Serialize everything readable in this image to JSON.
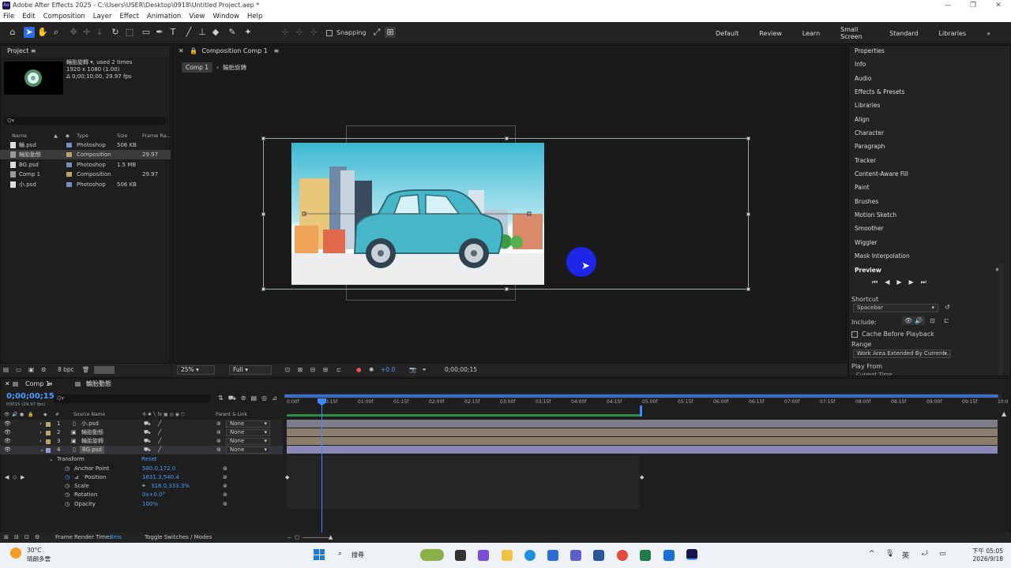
{
  "window": {
    "title": "Adobe After Effects 2025 - C:\\Users\\USER\\Desktop\\0918\\Untitled Project.aep *"
  },
  "menu": [
    "File",
    "Edit",
    "Composition",
    "Layer",
    "Effect",
    "Animation",
    "View",
    "Window",
    "Help"
  ],
  "toolbar": {
    "snapping_label": "Snapping"
  },
  "workspaces": [
    "Default",
    "Review",
    "Learn",
    "Small Screen",
    "Standard",
    "Libraries"
  ],
  "project": {
    "title": "Project",
    "selected_name": "輪胎旋轉",
    "used": ", used 2 times",
    "dims": "1920 x 1080 (1.00)",
    "duration": "Δ 0;00;10;00, 29.97 fps",
    "search_placeholder": "Q▾",
    "columns": [
      "Name",
      "Type",
      "Size",
      "Frame Ra..."
    ],
    "rows": [
      {
        "name": "輪.psd",
        "type": "Photoshop",
        "size": "506 KB",
        "rate": ""
      },
      {
        "name": "輪胎動態",
        "type": "Composition",
        "size": "",
        "rate": "29.97"
      },
      {
        "name": "BG.psd",
        "type": "Photoshop",
        "size": "1.5 MB",
        "rate": ""
      },
      {
        "name": "Comp 1",
        "type": "Composition",
        "size": "",
        "rate": "29.97"
      },
      {
        "name": "小.psd",
        "type": "Photoshop",
        "size": "506 KB",
        "rate": ""
      }
    ],
    "bpc": "8 bpc"
  },
  "comp": {
    "tab": "Composition Comp 1",
    "crumb_active": "Comp 1",
    "crumb_next": "輪胎旋轉",
    "zoom": "25%",
    "resolution": "Full",
    "exposure": "+0.0",
    "timecode": "0;00;00;15"
  },
  "right_panel": [
    "Properties",
    "Info",
    "Audio",
    "Effects & Presets",
    "Libraries",
    "Align",
    "Character",
    "Paragraph",
    "Tracker",
    "Content-Aware Fill",
    "Paint",
    "Brushes",
    "Motion Sketch",
    "Smoother",
    "Wiggler",
    "Mask Interpolation"
  ],
  "preview": {
    "title": "Preview",
    "shortcut_label": "Shortcut",
    "shortcut_value": "Spacebar",
    "include_label": "Include:",
    "cache_label": "Cache Before Playback",
    "range_label": "Range",
    "range_value": "Work Area Extended By Current...",
    "playfrom_label": "Play From",
    "playfrom_value": "Current Time"
  },
  "timeline": {
    "tab1": "Comp 1",
    "tab2": "輪胎動態",
    "timecode": "0;00;00;15",
    "timecode_sub": "00015 (29.97 fps)",
    "col_source": "Source Name",
    "col_parent": "Parent & Link",
    "layers": [
      {
        "num": "1",
        "name": "小.psd",
        "parent": "None",
        "color": "#b8a46c"
      },
      {
        "num": "2",
        "name": "輪胎動態",
        "parent": "None",
        "color": "#b8a46c"
      },
      {
        "num": "3",
        "name": "輪胎旋轉",
        "parent": "None",
        "color": "#b8a46c"
      },
      {
        "num": "4",
        "name": "BG.psd",
        "parent": "None",
        "color": "#9d9ad0"
      }
    ],
    "transform": {
      "label": "Transform",
      "reset": "Reset"
    },
    "props": [
      {
        "name": "Anchor Point",
        "value": "580.0,172.0"
      },
      {
        "name": "Position",
        "value": "1631.3,540.4"
      },
      {
        "name": "Scale",
        "value": "318.0,333.3%"
      },
      {
        "name": "Rotation",
        "value": "0x+0.0°"
      },
      {
        "name": "Opacity",
        "value": "100%"
      }
    ],
    "ticks": [
      "0:00f",
      "00:15f",
      "01:00f",
      "01:15f",
      "02:00f",
      "02:15f",
      "03:00f",
      "03:15f",
      "04:00f",
      "04:15f",
      "05:00f",
      "05:15f",
      "06:00f",
      "06:15f",
      "07:00f",
      "07:15f",
      "08:00f",
      "08:15f",
      "09:00f",
      "09:15f",
      "10:0"
    ],
    "frame_render_label": "Frame Render Time:",
    "frame_render_value": "8ms",
    "toggle_label": "Toggle Switches / Modes"
  },
  "taskbar": {
    "weather_temp": "30°C",
    "weather_desc": "晴朗多雲",
    "search": "搜尋",
    "ime": "英",
    "time": "下午 05:05",
    "date": "2026/9/18"
  }
}
